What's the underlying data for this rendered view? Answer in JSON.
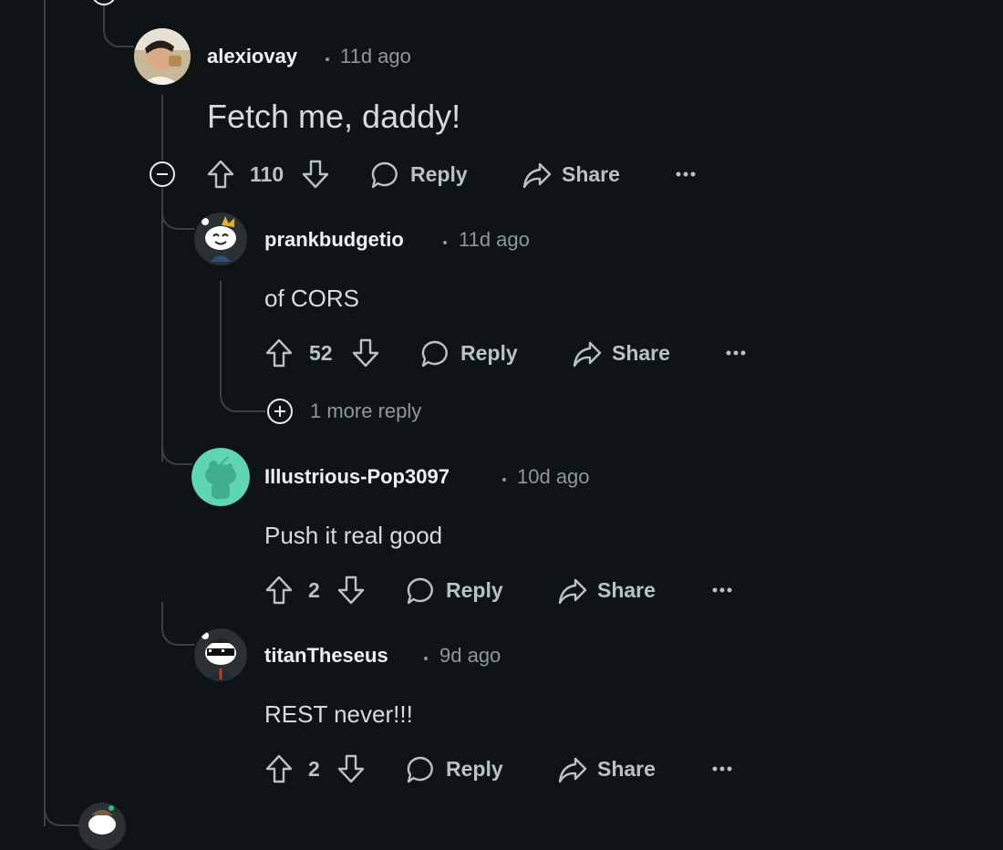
{
  "comments": {
    "c1": {
      "author": "alexiovay",
      "time": "11d ago",
      "body": "Fetch me, daddy!",
      "score": "110"
    },
    "c2": {
      "author": "prankbudgetio",
      "time": "11d ago",
      "body": "of CORS",
      "score": "52"
    },
    "c3": {
      "author": "Illustrious-Pop3097",
      "time": "10d ago",
      "body": "Push it real good",
      "score": "2"
    },
    "c4": {
      "author": "titanTheseus",
      "time": "9d ago",
      "body": "REST never!!!",
      "score": "2"
    }
  },
  "actions": {
    "reply": "Reply",
    "share": "Share"
  },
  "more_replies": "1 more reply",
  "colors": {
    "background": "#0e1415",
    "thread_line": "#3a4244",
    "text_muted": "#8d989c",
    "action": "#b8c2c5"
  },
  "icons": [
    "upvote-icon",
    "downvote-icon",
    "reply-bubble-icon",
    "share-arrow-icon",
    "more-dots-icon",
    "collapse-icon",
    "expand-icon"
  ]
}
